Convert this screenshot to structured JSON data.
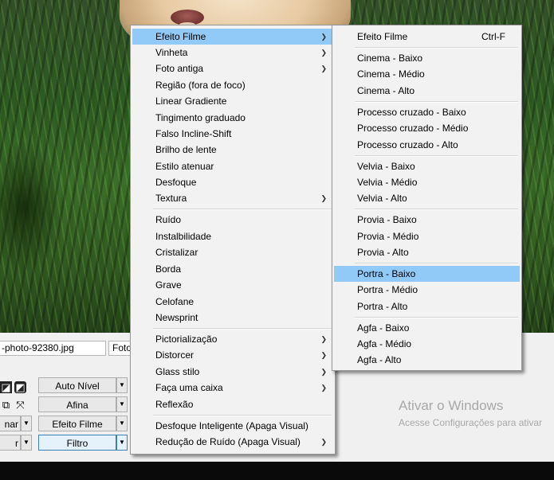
{
  "filename_tab": "-photo-92380.jpg",
  "foto_tab": "Foto",
  "panel_buttons": {
    "auto_nivel": "Auto Nível",
    "afina": "Afina",
    "efeito_filme": "Efeito Filme",
    "filtro": "Filtro",
    "left_row3": "nar",
    "left_row4": "r"
  },
  "watermark": {
    "title": "Ativar o Windows",
    "subtitle": "Acesse Configurações para ativar"
  },
  "menu_main": {
    "items": [
      {
        "label": "Efeito Filme",
        "submenu": true
      },
      {
        "label": "Vinheta",
        "submenu": true
      },
      {
        "label": "Foto antiga",
        "submenu": true
      },
      {
        "label": "Região (fora de foco)"
      },
      {
        "label": "Linear Gradiente"
      },
      {
        "label": "Tingimento graduado"
      },
      {
        "label": "Falso Incline-Shift"
      },
      {
        "label": "Brilho de lente"
      },
      {
        "label": "Estilo atenuar"
      },
      {
        "label": "Desfoque"
      },
      {
        "label": "Textura",
        "submenu": true
      },
      {
        "label": "Ruído"
      },
      {
        "label": "Instalbilidade"
      },
      {
        "label": "Cristalizar"
      },
      {
        "label": "Borda"
      },
      {
        "label": "Grave"
      },
      {
        "label": "Celofane"
      },
      {
        "label": "Newsprint"
      },
      {
        "label": "Pictorialização",
        "submenu": true
      },
      {
        "label": "Distorcer",
        "submenu": true
      },
      {
        "label": "Glass stilo",
        "submenu": true
      },
      {
        "label": "Faça uma caixa",
        "submenu": true
      },
      {
        "label": "Reflexão"
      },
      {
        "label": "Desfoque Inteligente (Apaga Visual)"
      },
      {
        "label": "Redução de Ruído (Apaga Visual)",
        "submenu": true
      }
    ]
  },
  "menu_sub": {
    "items": [
      {
        "label": "Efeito Filme",
        "shortcut": "Ctrl-F"
      },
      {
        "label": "Cinema - Baixo"
      },
      {
        "label": "Cinema - Médio"
      },
      {
        "label": "Cinema - Alto"
      },
      {
        "label": "Processo cruzado - Baixo"
      },
      {
        "label": "Processo cruzado - Médio"
      },
      {
        "label": "Processo cruzado - Alto"
      },
      {
        "label": "Velvia - Baixo"
      },
      {
        "label": "Velvia - Médio"
      },
      {
        "label": "Velvia - Alto"
      },
      {
        "label": "Provia - Baixo"
      },
      {
        "label": "Provia - Médio"
      },
      {
        "label": "Provia - Alto"
      },
      {
        "label": "Portra - Baixo"
      },
      {
        "label": "Portra - Médio"
      },
      {
        "label": "Portra - Alto"
      },
      {
        "label": "Agfa - Baixo"
      },
      {
        "label": "Agfa - Médio"
      },
      {
        "label": "Agfa - Alto"
      }
    ]
  },
  "highlight_color": "#91c9f7",
  "arrow_glyph": "❯"
}
